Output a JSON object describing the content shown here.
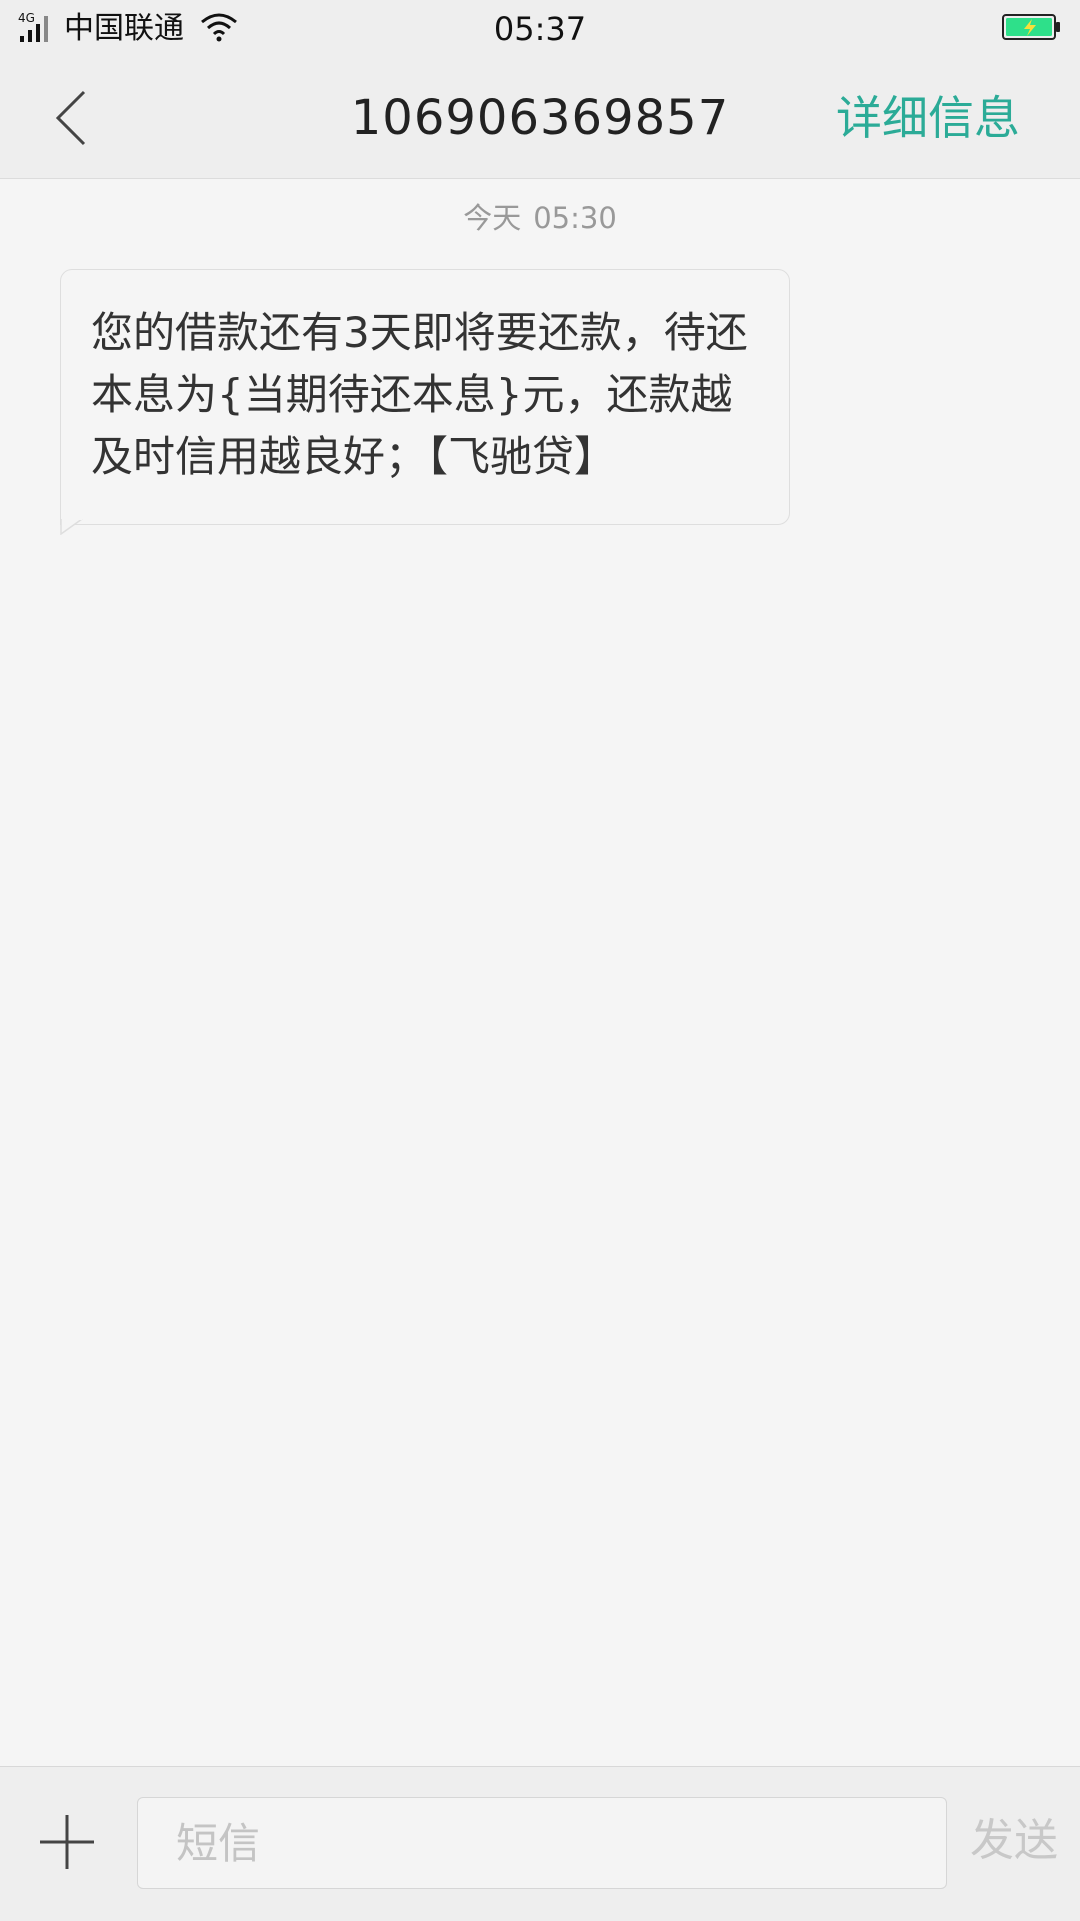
{
  "status_bar": {
    "network_type": "4G",
    "carrier": "中国联通",
    "time": "05:37",
    "battery_color": "#2ee08a",
    "icons": [
      "signal-icon",
      "wifi-icon",
      "battery-charging-icon"
    ]
  },
  "nav": {
    "title": "106906369857",
    "details_label": "详细信息",
    "accent_color": "#2bab97",
    "back_icon": "chevron-left-icon"
  },
  "messages": {
    "timestamp_day": "今天",
    "timestamp_time": "05:30",
    "items": [
      {
        "direction": "incoming",
        "text": "您的借款还有3天即将要还款，待还本息为{当期待还本息}元，还款越及时信用越良好；【飞驰贷】"
      }
    ]
  },
  "compose": {
    "add_icon": "plus-icon",
    "placeholder": "短信",
    "value": "",
    "send_label": "发送"
  }
}
